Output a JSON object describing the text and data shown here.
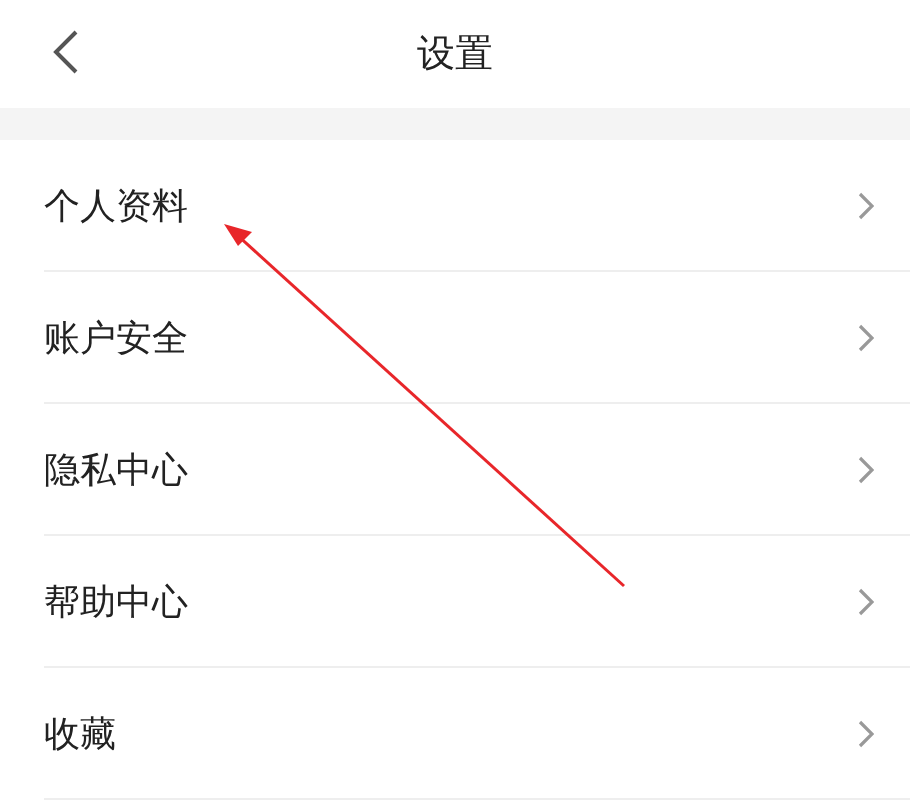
{
  "header": {
    "title": "设置"
  },
  "menu": [
    {
      "label": "个人资料"
    },
    {
      "label": "账户安全"
    },
    {
      "label": "隐私中心"
    },
    {
      "label": "帮助中心"
    },
    {
      "label": "收藏"
    }
  ]
}
